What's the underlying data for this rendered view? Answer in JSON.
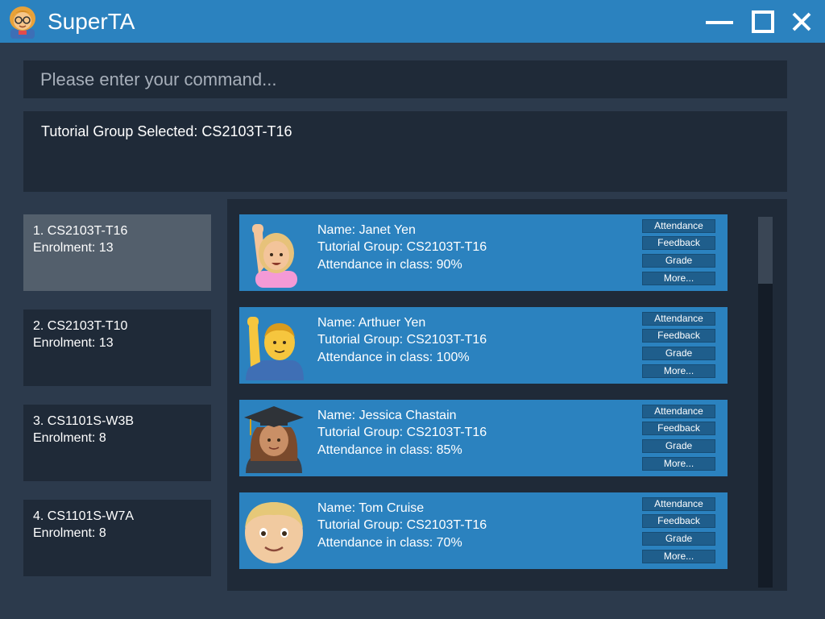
{
  "app": {
    "title": "SuperTA",
    "icon": "teacher-emoji-icon",
    "accent_color": "#2b82bf"
  },
  "window_controls": {
    "minimize_icon": "minimize-icon",
    "maximize_icon": "maximize-icon",
    "close_icon": "close-icon"
  },
  "command": {
    "placeholder": "Please enter your command...",
    "value": ""
  },
  "result": {
    "text": "Tutorial Group Selected: CS2103T-T16"
  },
  "groups": [
    {
      "title": "1. CS2103T-T16",
      "enrolment": "Enrolment: 13",
      "selected": true
    },
    {
      "title": "2. CS2103T-T10",
      "enrolment": "Enrolment: 13",
      "selected": false
    },
    {
      "title": "3. CS1101S-W3B",
      "enrolment": "Enrolment: 8",
      "selected": false
    },
    {
      "title": "4. CS1101S-W7A",
      "enrolment": "Enrolment: 8",
      "selected": false
    }
  ],
  "students": [
    {
      "name": "Name: Janet Yen",
      "group": "Tutorial Group: CS2103T-T16",
      "attendance": "Attendance in class: 90%",
      "avatar": "woman-raising-hand-icon"
    },
    {
      "name": "Name: Arthuer Yen",
      "group": "Tutorial Group: CS2103T-T16",
      "attendance": "Attendance in class: 100%",
      "avatar": "man-raising-hand-icon"
    },
    {
      "name": "Name: Jessica Chastain",
      "group": "Tutorial Group: CS2103T-T16",
      "attendance": "Attendance in class: 85%",
      "avatar": "woman-graduate-icon"
    },
    {
      "name": "Name: Tom Cruise",
      "group": "Tutorial Group: CS2103T-T16",
      "attendance": "Attendance in class: 70%",
      "avatar": "boy-face-icon"
    }
  ],
  "student_actions": {
    "attendance": "Attendance",
    "feedback": "Feedback",
    "grade": "Grade",
    "more": "More..."
  }
}
